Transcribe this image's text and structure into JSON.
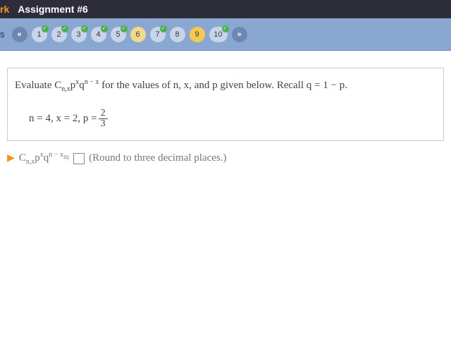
{
  "header": {
    "brand_suffix": "rk",
    "title": "Assignment #6"
  },
  "nav": {
    "tab_label": "s",
    "prev": "«",
    "next": "»",
    "questions": [
      {
        "label": "1",
        "checked": true,
        "active": false,
        "highlight": false
      },
      {
        "label": "2",
        "checked": true,
        "active": false,
        "highlight": false
      },
      {
        "label": "3",
        "checked": true,
        "active": false,
        "highlight": false
      },
      {
        "label": "4",
        "checked": true,
        "active": false,
        "highlight": false
      },
      {
        "label": "5",
        "checked": true,
        "active": false,
        "highlight": false
      },
      {
        "label": "6",
        "checked": false,
        "active": true,
        "highlight": false
      },
      {
        "label": "7",
        "checked": true,
        "active": false,
        "highlight": false
      },
      {
        "label": "8",
        "checked": false,
        "active": false,
        "highlight": false
      },
      {
        "label": "9",
        "checked": false,
        "active": false,
        "highlight": true
      },
      {
        "label": "10",
        "checked": true,
        "active": false,
        "highlight": false
      }
    ]
  },
  "question": {
    "prompt_prefix": "Evaluate ",
    "formula_C": "C",
    "formula_sub": "n,x",
    "formula_p": "p",
    "formula_supx": "x",
    "formula_q": "q",
    "formula_supnx": "n − x",
    "prompt_mid": " for the values of n, x, and p given below. Recall q = 1 − p.",
    "given_prefix": "n = 4, x = 2, p = ",
    "frac_num": "2",
    "frac_den": "3"
  },
  "answer": {
    "approx": " ≈ ",
    "input_value": "",
    "hint": "(Round to three decimal places.)"
  }
}
